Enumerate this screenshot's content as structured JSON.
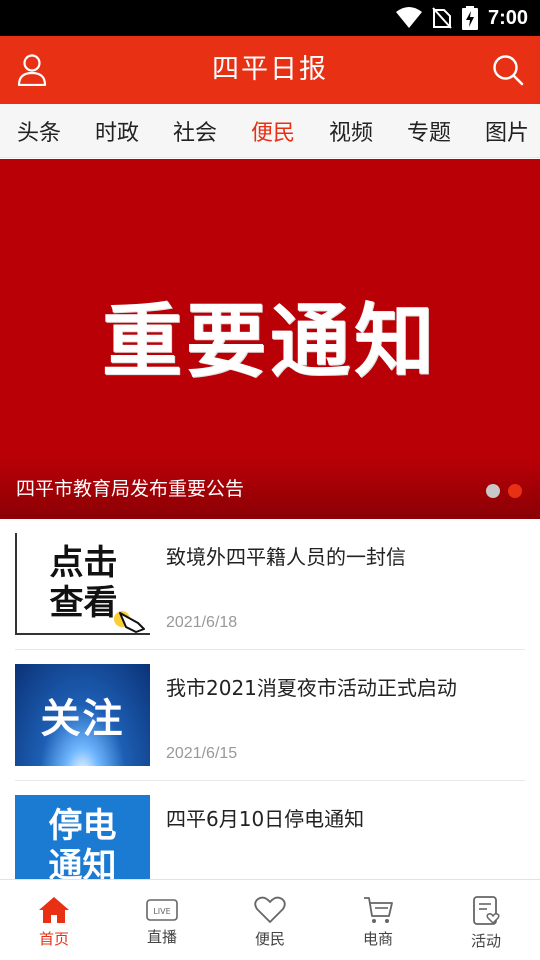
{
  "status_bar": {
    "time": "7:00"
  },
  "app_bar": {
    "title": "四平日报"
  },
  "tabs": [
    {
      "label": "头条"
    },
    {
      "label": "时政"
    },
    {
      "label": "社会"
    },
    {
      "label": "便民",
      "active": true
    },
    {
      "label": "视频"
    },
    {
      "label": "专题"
    },
    {
      "label": "图片"
    }
  ],
  "banner": {
    "image_text": "重要通知",
    "caption": "四平市教育局发布重要公告",
    "slide_count": 2,
    "active_slide": 2
  },
  "news": [
    {
      "title": "致境外四平籍人员的一封信",
      "date": "2021/6/18",
      "thumb_text_1": "点击",
      "thumb_text_2": "查看"
    },
    {
      "title": "我市2021消夏夜市活动正式启动",
      "date": "2021/6/15",
      "thumb_text_1": "关注"
    },
    {
      "title": "四平6月10日停电通知",
      "date": "",
      "thumb_text_1": "停电",
      "thumb_text_2": "通知"
    }
  ],
  "bottom_nav": [
    {
      "label": "首页",
      "icon": "home-icon",
      "active": true
    },
    {
      "label": "直播",
      "icon": "live-icon"
    },
    {
      "label": "便民",
      "icon": "heart-icon"
    },
    {
      "label": "电商",
      "icon": "cart-icon"
    },
    {
      "label": "活动",
      "icon": "activity-icon"
    }
  ],
  "colors": {
    "brand_red": "#e83015",
    "banner_red": "#b80006"
  }
}
